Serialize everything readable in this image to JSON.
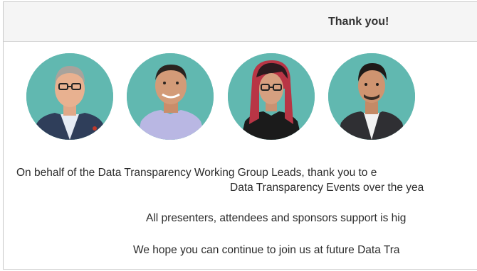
{
  "header": {
    "title": "Thank you!"
  },
  "avatars": [
    {
      "icon": "team-lead-photo-1"
    },
    {
      "icon": "team-lead-photo-2"
    },
    {
      "icon": "team-lead-photo-3"
    },
    {
      "icon": "team-lead-photo-4"
    }
  ],
  "message": {
    "line1": "On behalf of the Data Transparency Working Group Leads, thank you to e",
    "line2": "Data Transparency Events over the yea",
    "line3": "All presenters, attendees and sponsors support is hig",
    "line4": "We hope you can continue to join us at future Data Tra"
  },
  "colors": {
    "avatar_bg": "#61b8b0",
    "header_bg": "#f5f5f5",
    "border": "#c9c9c9"
  }
}
